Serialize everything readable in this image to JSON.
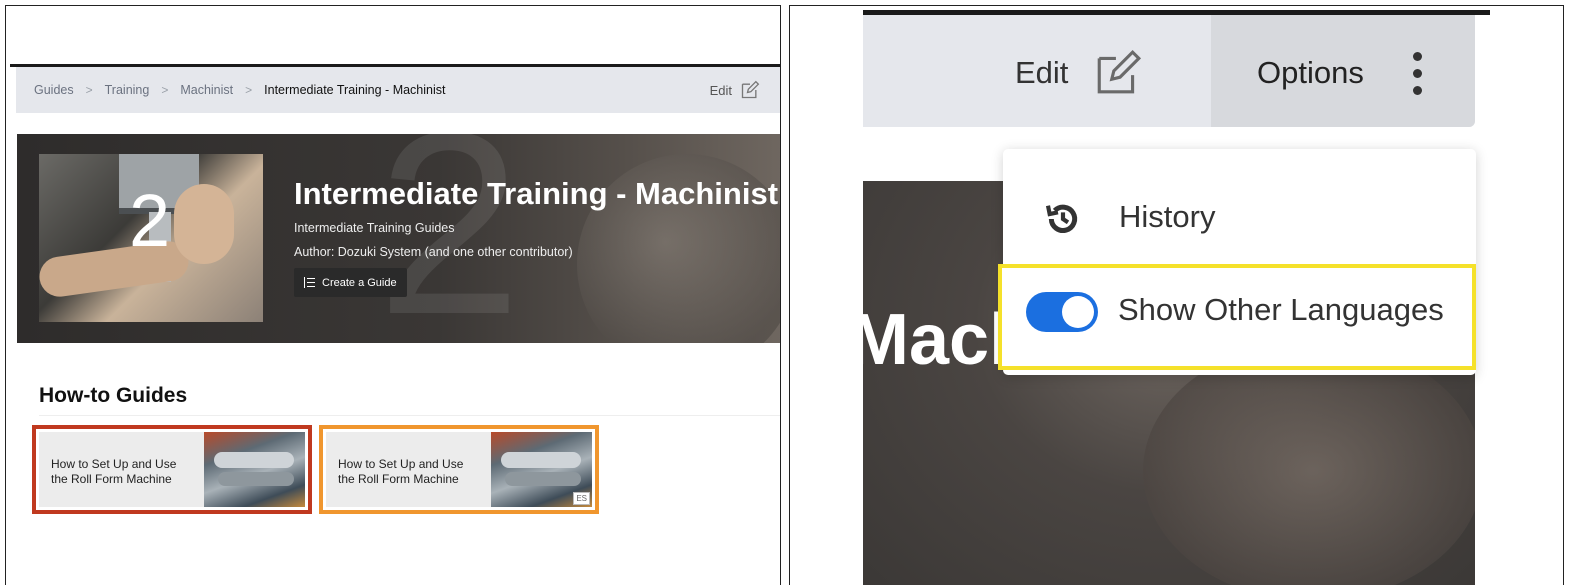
{
  "left": {
    "breadcrumb": [
      "Guides",
      "Training",
      "Machinist",
      "Intermediate Training - Machinist"
    ],
    "edit_label": "Edit",
    "hero": {
      "thumb_number": "2",
      "title": "Intermediate Training - Machinist",
      "subtitle": "Intermediate Training Guides",
      "author": "Author: Dozuki System (and one other contributor)",
      "create_button": "Create a Guide",
      "watermark_number": "2"
    },
    "section_title": "How-to Guides",
    "guides": [
      {
        "title": "How to Set Up and Use the Roll Form Machine",
        "highlight": "#c0391f",
        "badge": ""
      },
      {
        "title": "How to Set Up and Use the Roll Form Machine",
        "highlight": "#f0962e",
        "badge": "ES"
      }
    ]
  },
  "right": {
    "edit_label": "Edit",
    "options_label": "Options",
    "hero_text": "Mach",
    "menu": {
      "history_label": "History",
      "show_languages_label": "Show Other Languages",
      "show_languages_on": true
    },
    "toggle_color": "#1b6fe0",
    "highlight_color": "#f5e12a"
  }
}
